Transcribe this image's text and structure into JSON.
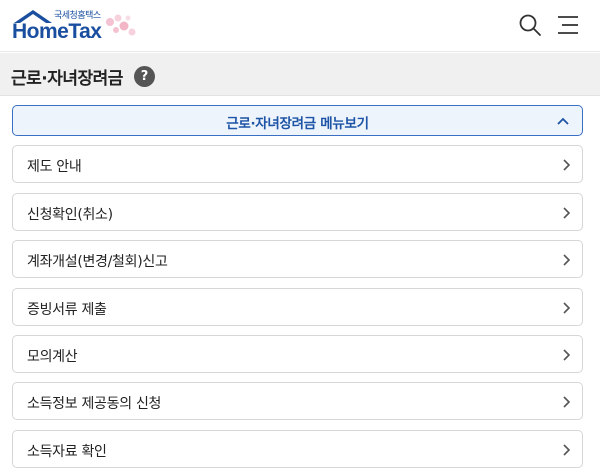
{
  "header": {
    "logo_sub": "국세청홈택스",
    "logo_main": "HomeTax"
  },
  "page": {
    "title": "근로·자녀장려금",
    "help_label": "?"
  },
  "menu_toggle": {
    "label": "근로·자녀장려금 메뉴보기"
  },
  "items": [
    {
      "label": "제도 안내"
    },
    {
      "label": "신청확인(취소)"
    },
    {
      "label": "계좌개설(변경/철회)신고"
    },
    {
      "label": "증빙서류 제출"
    },
    {
      "label": "모의계산"
    },
    {
      "label": "소득정보 제공동의 신청"
    },
    {
      "label": "소득자료 확인"
    }
  ],
  "colors": {
    "brand": "#1a4fa0",
    "accent_border": "#3a70c4",
    "toggle_bg": "#eef4fc"
  }
}
